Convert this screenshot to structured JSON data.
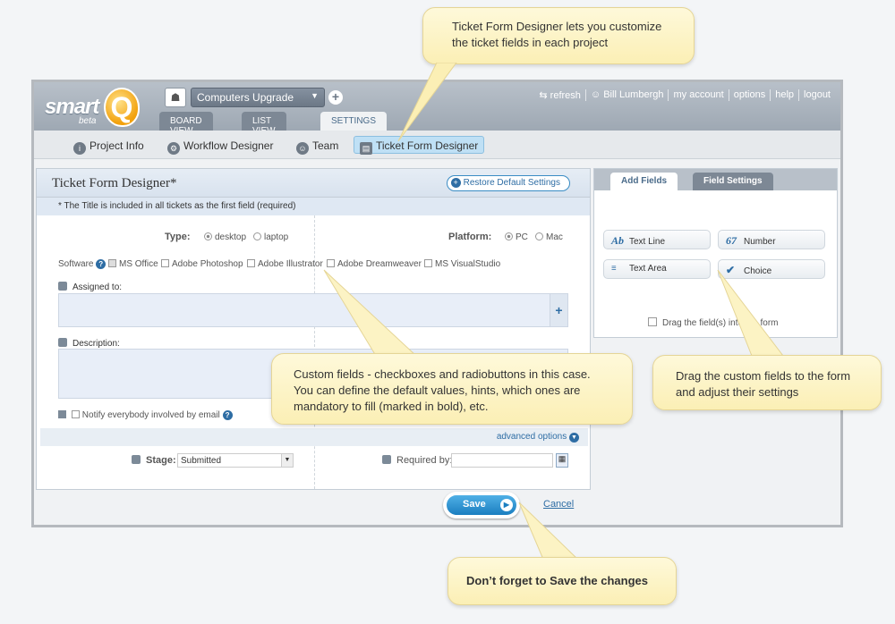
{
  "app": {
    "logo_text": "smart",
    "logo_q": "Q",
    "logo_beta": "beta",
    "project_name": "Computers Upgrade",
    "tabs": [
      "BOARD VIEW",
      "LIST VIEW",
      "SETTINGS"
    ],
    "toplinks": [
      "refresh",
      "Bill Lumbergh",
      "my account",
      "options",
      "help",
      "logout"
    ]
  },
  "subnav": [
    "Project Info",
    "Workflow Designer",
    "Team",
    "Ticket Form Designer"
  ],
  "form": {
    "title": "Ticket Form Designer*",
    "restore_label": "Restore Default Settings",
    "note": "* The Title is included in all tickets as the first field (required)",
    "type_label": "Type:",
    "type_options": [
      "desktop",
      "laptop"
    ],
    "platform_label": "Platform:",
    "platform_options": [
      "PC",
      "Mac"
    ],
    "software_label": "Software",
    "software_options": [
      "MS Office",
      "Adobe Photoshop",
      "Adobe Illustrator",
      "Adobe Dreamweaver",
      "MS VisualStudio"
    ],
    "assigned_label": "Assigned to:",
    "description_label": "Description:",
    "notify_label": "Notify everybody involved by email",
    "advanced_label": "advanced options",
    "stage_label": "Stage:",
    "stage_value": "Submitted",
    "required_label": "Required by:"
  },
  "actions": {
    "save": "Save",
    "cancel": "Cancel"
  },
  "right_panel": {
    "tabs": [
      "Add Fields",
      "Field Settings"
    ],
    "fields": [
      {
        "icon": "Ab",
        "label": "Text Line"
      },
      {
        "icon": "67",
        "label": "Number"
      },
      {
        "icon": "≡",
        "label": "Text Area"
      },
      {
        "icon": "✔",
        "label": "Choice"
      }
    ],
    "drag_hint": "Drag the field(s) into the form"
  },
  "callouts": {
    "top": "Ticket Form Designer lets you customize the ticket fields in each project",
    "middle": "Custom fields - checkboxes and radiobuttons in this case. You can define the default values, hints, which ones are mandatory to fill (marked in bold), etc.",
    "right": "Drag the custom fields to the form and adjust their settings",
    "bottom": "Don’t forget to Save the changes"
  }
}
